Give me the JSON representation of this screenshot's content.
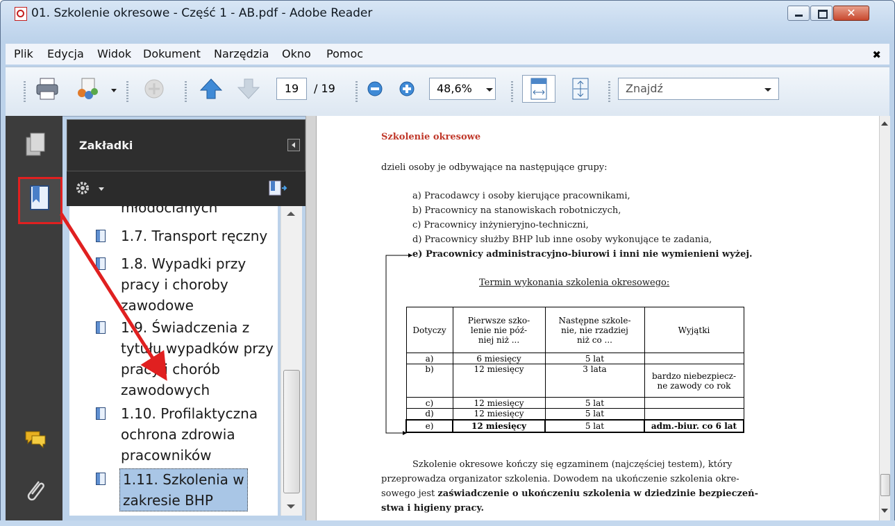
{
  "window": {
    "title": "01. Szkolenie okresowe - Część 1 - AB.pdf - Adobe Reader",
    "close_glyph": "✕"
  },
  "menu": {
    "items": [
      "Plik",
      "Edycja",
      "Widok",
      "Dokument",
      "Narzędzia",
      "Okno",
      "Pomoc"
    ],
    "close_glyph": "✖"
  },
  "toolbar": {
    "page_current": "19",
    "page_total": "/ 19",
    "zoom": "48,6%",
    "find_placeholder": "Znajdź"
  },
  "bookmarks": {
    "title": "Zakładki",
    "items": [
      {
        "label": "młodocianych"
      },
      {
        "label": "1.7. Transport ręczny"
      },
      {
        "label": "1.8. Wypadki przy\npracy i choroby\nzawodowe"
      },
      {
        "label": "1.9. Świadczenia z\ntytułu wypadków przy\npracy i chorób\nzawodowych"
      },
      {
        "label": "1.10. Profilaktyczna\nochrona zdrowia\npracowników"
      },
      {
        "label": "1.11. Szkolenia w\nzakresie BHP",
        "selected": true
      }
    ]
  },
  "document": {
    "heading": "Szkolenie okresowe",
    "intro": "dzieli osoby je odbywające na następujące grupy:",
    "groups": [
      "a)  Pracodawcy i osoby kierujące pracownikami,",
      "b)  Pracownicy na stanowiskach robotniczych,",
      "c)  Pracownicy inżynieryjno-techniczni,",
      "d)  Pracownicy służby BHP lub inne osoby wykonujące te zadania,",
      "e)  Pracownicy administracyjno-biurowi i inni nie wymienieni wyżej."
    ],
    "table_title": "Termin wykonania szkolenia okresowego:",
    "table_headers": [
      "Dotyczy",
      "Pierwsze szko-\nlenie nie póź-\nniej niż ...",
      "Następne szkole-\nnie, nie rzadziej\nniż co ...",
      "Wyjątki"
    ],
    "table_rows": [
      [
        "a)",
        "6 miesięcy",
        "5 lat",
        ""
      ],
      [
        "b)",
        "12 miesięcy",
        "3 lata",
        "bardzo niebezpiecz-\nne zawody co rok"
      ],
      [
        "c)",
        "12 miesięcy",
        "5 lat",
        ""
      ],
      [
        "d)",
        "12 miesięcy",
        "5 lat",
        ""
      ],
      [
        "e)",
        "12 miesięcy",
        "5 lat",
        "adm.-biur. co 6 lat"
      ]
    ],
    "para": [
      "Szkolenie okresowe kończy się egzaminem (najczęściej testem), który",
      "przeprowadza organizator szkolenia. Dowodem na ukończenie szkolenia okre-",
      "sowego jest ",
      "zaświadczenie o ukończeniu szkolenia w dziedzinie bezpieczeń-",
      "stwa i higieny pracy."
    ]
  },
  "colors": {
    "highlight_red": "#e02020",
    "selected_bookmark": "#a9c6e6",
    "heading_red": "#c0392b"
  }
}
